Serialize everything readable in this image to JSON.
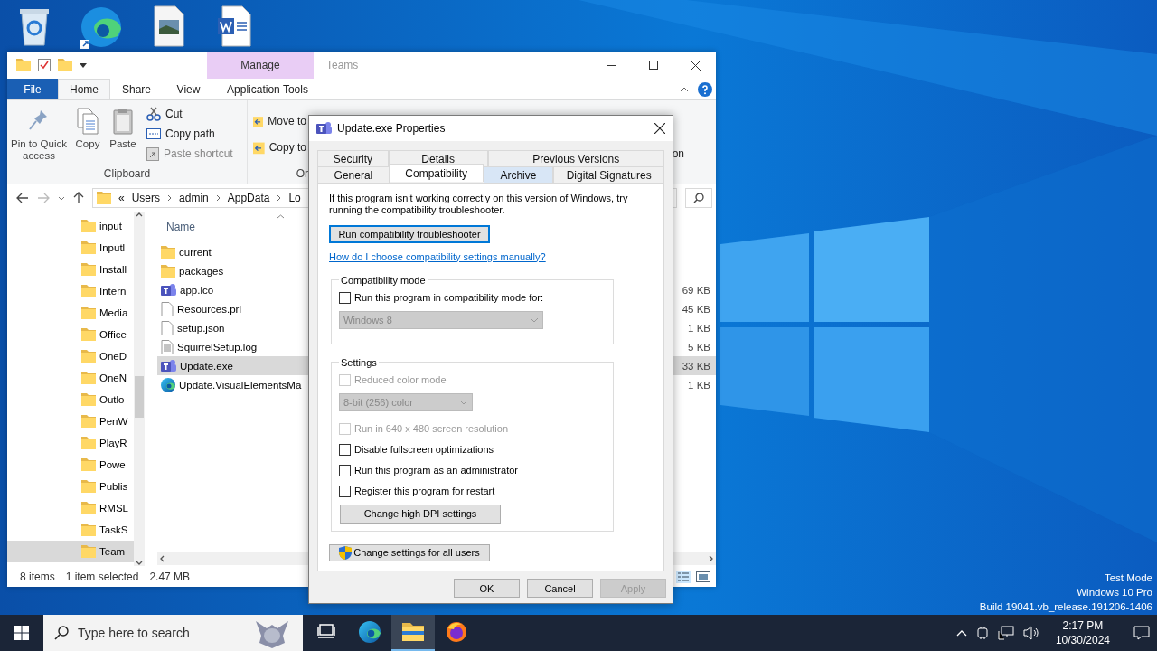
{
  "desktop_icons": [
    {
      "kind": "recycle"
    },
    {
      "kind": "edge"
    },
    {
      "kind": "image"
    },
    {
      "kind": "word"
    }
  ],
  "explorer": {
    "contextual_tab": "Manage",
    "title": "Teams",
    "ribbon_tabs": [
      {
        "label": "File",
        "kind": "file",
        "selected": false
      },
      {
        "label": "Home",
        "kind": "tab",
        "selected": true
      },
      {
        "label": "Share",
        "kind": "tab",
        "selected": false
      },
      {
        "label": "View",
        "kind": "tab",
        "selected": false
      },
      {
        "label": "Application Tools",
        "kind": "tab",
        "selected": false
      }
    ],
    "clipboard": {
      "large_buttons": [
        {
          "label": "Pin to Quick access",
          "kind": "pin"
        },
        {
          "label": "Copy",
          "kind": "copy"
        },
        {
          "label": "Paste",
          "kind": "paste"
        }
      ],
      "small_buttons": [
        {
          "label": "Cut",
          "kind": "cut",
          "disabled": false
        },
        {
          "label": "Copy path",
          "kind": "path",
          "disabled": false
        },
        {
          "label": "Paste shortcut",
          "kind": "shortcut",
          "disabled": true
        }
      ],
      "group_label": "Clipboard"
    },
    "organize": {
      "buttons": [
        "Move to",
        "Copy to"
      ],
      "group_label": "Or"
    },
    "ribbon_fragment": "on",
    "address": [
      "«",
      "Users",
      "admin",
      "AppData",
      "Lo"
    ],
    "nav_items": [
      {
        "label": "input",
        "selected": false
      },
      {
        "label": "Inputl",
        "selected": false
      },
      {
        "label": "Install",
        "selected": false
      },
      {
        "label": "Intern",
        "selected": false
      },
      {
        "label": "Media",
        "selected": false
      },
      {
        "label": "Office",
        "selected": false
      },
      {
        "label": "OneD",
        "selected": false
      },
      {
        "label": "OneN",
        "selected": false
      },
      {
        "label": "Outlo",
        "selected": false
      },
      {
        "label": "PenW",
        "selected": false
      },
      {
        "label": "PlayR",
        "selected": false
      },
      {
        "label": "Powe",
        "selected": false
      },
      {
        "label": "Publis",
        "selected": false
      },
      {
        "label": "RMSL",
        "selected": false
      },
      {
        "label": "TaskS",
        "selected": false
      },
      {
        "label": "Team",
        "selected": true
      }
    ],
    "column_header": "Name",
    "files": [
      {
        "name": "current",
        "kind": "folder",
        "selected": false
      },
      {
        "name": "packages",
        "kind": "folder",
        "selected": false
      },
      {
        "name": "app.ico",
        "kind": "teams",
        "size": "69 KB",
        "selected": false
      },
      {
        "name": "Resources.pri",
        "kind": "file",
        "size": "45 KB",
        "selected": false
      },
      {
        "name": "setup.json",
        "kind": "file",
        "size": "1 KB",
        "selected": false
      },
      {
        "name": "SquirrelSetup.log",
        "kind": "log",
        "size": "5 KB",
        "selected": false
      },
      {
        "name": "Update.exe",
        "kind": "teams",
        "size": "33 KB",
        "selected": true
      },
      {
        "name": "Update.VisualElementsMa",
        "kind": "edge",
        "size": "1 KB",
        "selected": false
      }
    ],
    "status": [
      "8 items",
      "1 item selected",
      "2.47 MB"
    ]
  },
  "dialog": {
    "title": "Update.exe Properties",
    "tab_rows": [
      [
        {
          "label": "Security",
          "selected": false,
          "hovered": false
        },
        {
          "label": "Details",
          "selected": false,
          "hovered": false
        },
        {
          "label": "Previous Versions",
          "selected": false,
          "hovered": false
        }
      ],
      [
        {
          "label": "General",
          "selected": false,
          "hovered": false
        },
        {
          "label": "Compatibility",
          "selected": true,
          "hovered": false
        },
        {
          "label": "Archive",
          "selected": false,
          "hovered": true
        },
        {
          "label": "Digital Signatures",
          "selected": false,
          "hovered": false
        }
      ]
    ],
    "intro": "If this program isn't working correctly on this version of Windows, try running the compatibility troubleshooter.",
    "troubleshooter_button": "Run compatibility troubleshooter",
    "help_link": "How do I choose compatibility settings manually?",
    "compatibility_mode": {
      "label": "Compatibility mode",
      "checkbox": {
        "label": "Run this program in compatibility mode for:",
        "checked": false,
        "disabled": false
      },
      "select": {
        "value": "Windows 8",
        "disabled": true
      }
    },
    "settings": {
      "label": "Settings",
      "items": [
        {
          "kind": "checkbox",
          "label": "Reduced color mode",
          "checked": false,
          "disabled": true
        },
        {
          "kind": "select",
          "value": "8-bit (256) color",
          "disabled": true
        },
        {
          "kind": "checkbox",
          "label": "Run in 640 x 480 screen resolution",
          "checked": false,
          "disabled": true
        },
        {
          "kind": "checkbox",
          "label": "Disable fullscreen optimizations",
          "checked": false,
          "disabled": false
        },
        {
          "kind": "checkbox",
          "label": "Run this program as an administrator",
          "checked": false,
          "disabled": false
        },
        {
          "kind": "checkbox",
          "label": "Register this program for restart",
          "checked": false,
          "disabled": false
        },
        {
          "kind": "button",
          "label": "Change high DPI settings"
        }
      ]
    },
    "all_users_button": "Change settings for all users",
    "buttons": [
      {
        "label": "OK",
        "disabled": false
      },
      {
        "label": "Cancel",
        "disabled": false
      },
      {
        "label": "Apply",
        "disabled": true
      }
    ]
  },
  "os_info": [
    "Test Mode",
    "Windows 10 Pro",
    "Build 19041.vb_release.191206-1406"
  ],
  "taskbar": {
    "search_placeholder": "Type here to search",
    "apps": [
      {
        "kind": "taskview",
        "selected": false
      },
      {
        "kind": "edge",
        "selected": false
      },
      {
        "kind": "explorer",
        "selected": true
      },
      {
        "kind": "firefox",
        "selected": false
      }
    ],
    "time": "2:17 PM",
    "date": "10/30/2024"
  }
}
